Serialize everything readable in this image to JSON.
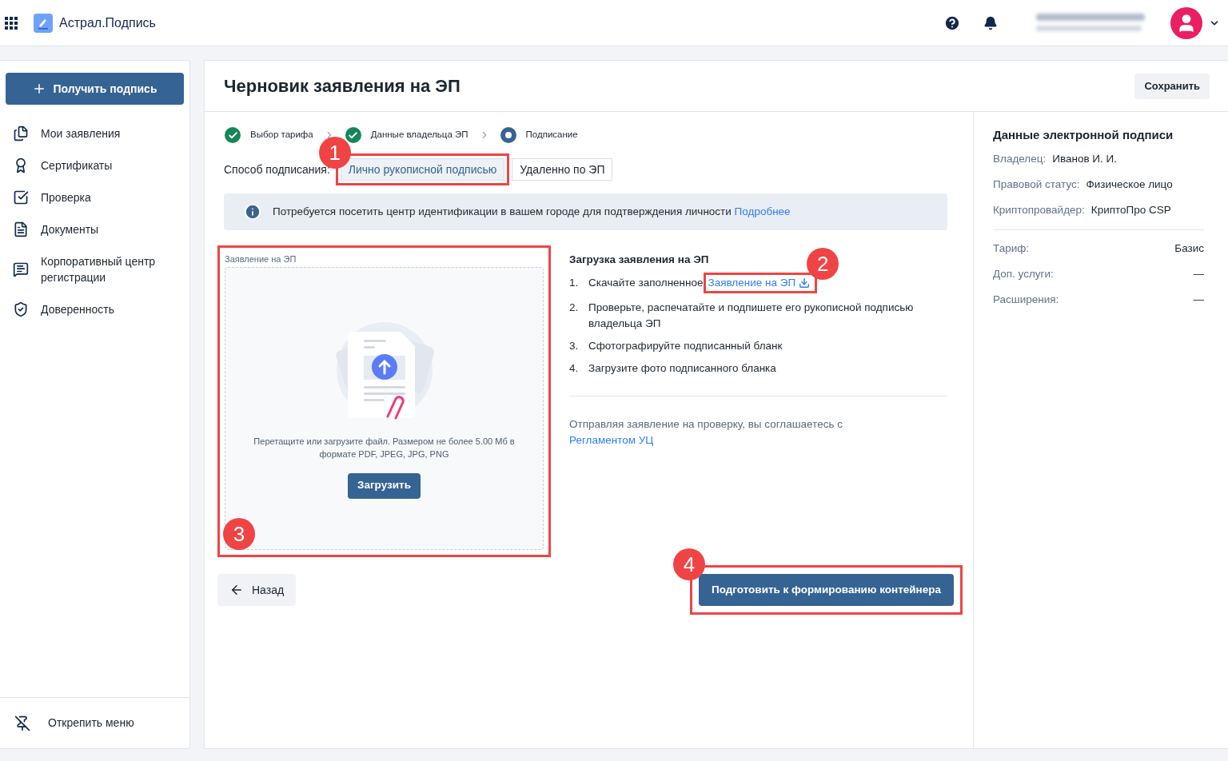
{
  "header": {
    "app_name": "Астрал.Подпись"
  },
  "sidebar": {
    "action": "Получить подпись",
    "items": [
      {
        "label": "Мои заявления"
      },
      {
        "label": "Сертификаты"
      },
      {
        "label": "Проверка"
      },
      {
        "label": "Документы"
      },
      {
        "label": "Корпоративный центр регистрации"
      },
      {
        "label": "Доверенность"
      }
    ],
    "footer": "Открепить меню"
  },
  "page": {
    "title": "Черновик заявления на ЭП",
    "save": "Сохранить"
  },
  "steps": [
    {
      "label": "Выбор тарифа",
      "done": true
    },
    {
      "label": "Данные владельца ЭП",
      "done": true
    },
    {
      "label": "Подписание",
      "done": false
    }
  ],
  "signing": {
    "label": "Способ подписания:",
    "options": [
      {
        "label": "Лично рукописной подписью",
        "selected": true,
        "callout": "1"
      },
      {
        "label": "Удаленно по ЭП",
        "selected": false
      }
    ]
  },
  "notice": {
    "text": "Потребуется посетить центр идентификации в вашем городе для подтверждения личности",
    "link": "Подробнее"
  },
  "upload": {
    "label": "Заявление на ЭП",
    "hint": "Перетащите или загрузите файл. Размером не более 5.00 Мб в формате PDF, JPEG, JPG, PNG",
    "button": "Загрузить",
    "callout": "3"
  },
  "instructions": {
    "title": "Загрузка заявления на ЭП",
    "steps": [
      {
        "number": "1.",
        "text": "Скачайте заполненное",
        "link": "Заявление на ЭП",
        "callout": "2"
      },
      {
        "number": "2.",
        "text": "Проверьте, распечатайте и подпишете его рукописной подписью владельца ЭП"
      },
      {
        "number": "3.",
        "text": "Сфотографируйте подписанный бланк"
      },
      {
        "number": "4.",
        "text": "Загрузите фото подписанного бланка"
      }
    ],
    "agreement": "Отправляя заявление на проверку, вы соглашаетесь с",
    "agreement_link": "Регламентом УЦ"
  },
  "actions": {
    "back": "Назад",
    "submit": "Подготовить к формированию контейнера",
    "submit_callout": "4"
  },
  "summary": {
    "title": "Данные электронной подписи",
    "owner": [
      {
        "label": "Владелец:",
        "value": "Иванов И. И."
      },
      {
        "label": "Правовой статус:",
        "value": "Физическое лицо"
      },
      {
        "label": "Криптопровайдер:",
        "value": "КриптоПро CSP"
      }
    ],
    "plan": [
      {
        "label": "Тариф:",
        "value": "Базис"
      },
      {
        "label": "Доп. услуги:",
        "value": "—"
      },
      {
        "label": "Расширения:",
        "value": "—"
      }
    ]
  }
}
